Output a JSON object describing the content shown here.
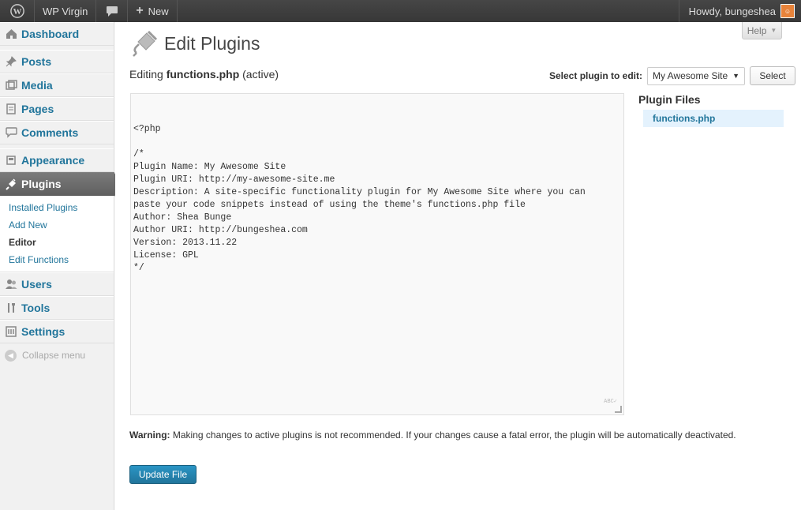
{
  "adminbar": {
    "site_name": "WP Virgin",
    "new_label": "New",
    "greeting": "Howdy, bungeshea"
  },
  "sidebar": {
    "items": [
      {
        "label": "Dashboard",
        "icon": "dashboard-icon"
      },
      {
        "label": "Posts",
        "icon": "pin-icon"
      },
      {
        "label": "Media",
        "icon": "media-icon"
      },
      {
        "label": "Pages",
        "icon": "pages-icon"
      },
      {
        "label": "Comments",
        "icon": "comment-icon"
      },
      {
        "label": "Appearance",
        "icon": "paintbrush-icon"
      },
      {
        "label": "Plugins",
        "icon": "plug-icon"
      },
      {
        "label": "Users",
        "icon": "users-icon"
      },
      {
        "label": "Tools",
        "icon": "tools-icon"
      },
      {
        "label": "Settings",
        "icon": "settings-icon"
      }
    ],
    "submenu": [
      "Installed Plugins",
      "Add New",
      "Editor",
      "Edit Functions"
    ],
    "collapse_label": "Collapse menu"
  },
  "main": {
    "help_label": "Help",
    "title": "Edit Plugins",
    "editing_prefix": "Editing",
    "editing_file": "functions.php",
    "editing_suffix": "(active)",
    "select_label": "Select plugin to edit:",
    "select_value": "My Awesome Site",
    "select_button": "Select",
    "code_lines": [
      "<?php",
      "",
      "/*",
      "Plugin Name: My Awesome Site",
      "Plugin URI: http://my-awesome-site.me",
      "Description: A site-specific functionality plugin for My Awesome Site where you can",
      "paste your code snippets instead of using the theme's functions.php file",
      "Author: Shea Bunge",
      "Author URI: http://bungeshea.com",
      "Version: 2013.11.22",
      "License: GPL",
      "*/"
    ],
    "files_heading": "Plugin Files",
    "file_item": "functions.php",
    "warning_label": "Warning:",
    "warning_text": "Making changes to active plugins is not recommended. If your changes cause a fatal error, the plugin will be automatically deactivated.",
    "update_button": "Update File"
  },
  "colors": {
    "link": "#21759b",
    "adminbar": "#464646",
    "button_primary": "#21759b"
  }
}
